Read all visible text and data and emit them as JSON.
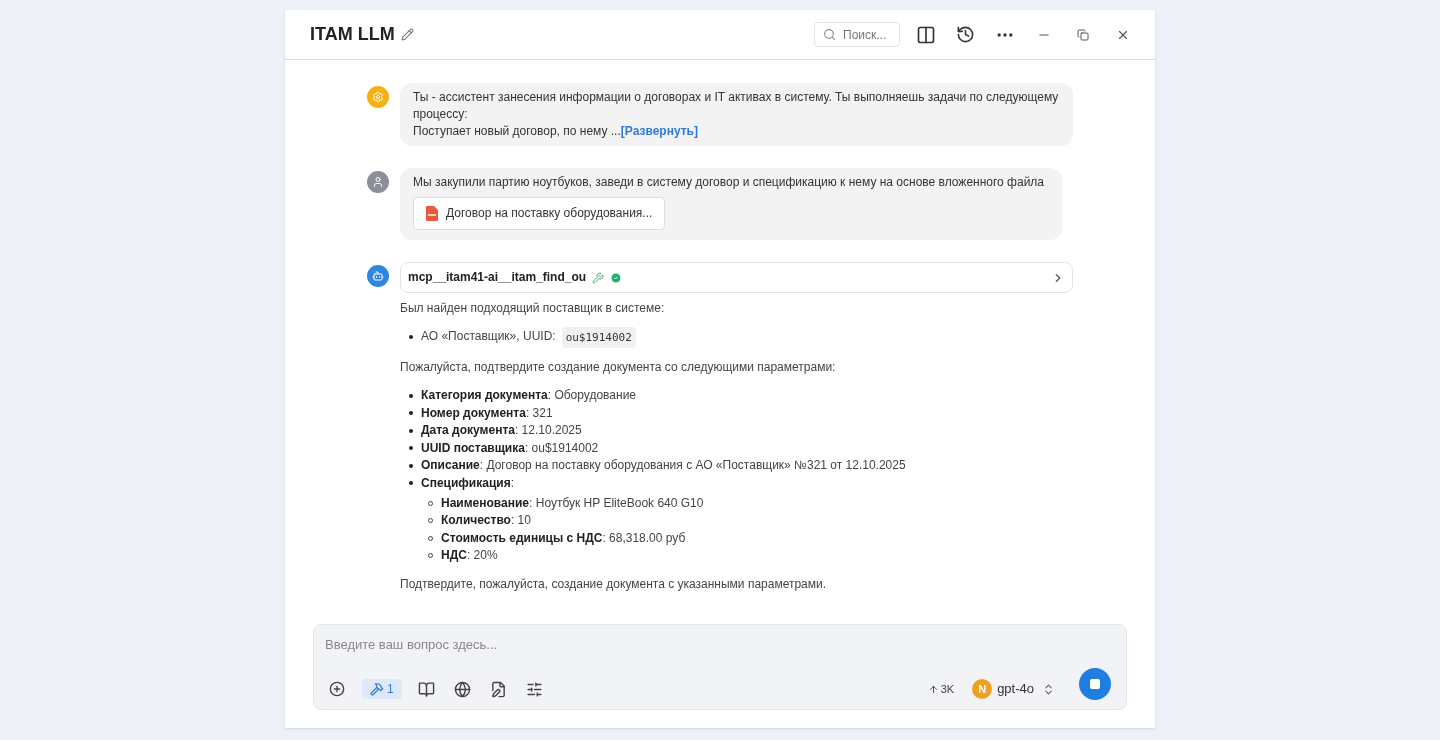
{
  "window": {
    "title": "ITAM LLM",
    "search_placeholder": "Поиск..."
  },
  "messages": [
    {
      "kind": "system",
      "lines": [
        "Ты - ассистент занесения информации о договорах и IT активах в систему. Ты выполняешь задачи по следующему процессу:",
        "Поступает новый договор, по нему ..."
      ],
      "expand_link": "[Развернуть]"
    },
    {
      "kind": "user",
      "text": "Мы закупили партию ноутбуков, заведи в систему договор и спецификацию к нему на основе вложенного файла",
      "attachment": "Договор на поставку оборудования..."
    },
    {
      "kind": "assistant",
      "tool_call": {
        "name": "mcp__itam41-ai__itam_find_ou",
        "success": true
      },
      "intro": "Был найден подходящий поставщик в системе:",
      "supplier": {
        "text": "АО «Поставщик», UUID:",
        "code": "ou$1914002"
      },
      "request": "Пожалуйста, подтвердите создание документа со следующими параметрами:",
      "params": [
        {
          "text": "**Категория документа**: Оборудование"
        },
        {
          "text": "**Номер документа**: 321"
        },
        {
          "text": "**Дата документа**: 12.10.2025"
        },
        {
          "text": "**UUID поставщика**: ou$1914002"
        },
        {
          "text": "**Описание**: Договор на поставку оборудования с АО «Поставщик» №321 от 12.10.2025"
        },
        {
          "text": "**Спецификация**:",
          "children": [
            {
              "text": "**Наименование**: Ноутбук HP EliteBook 640 G10"
            },
            {
              "text": "**Количество**: 10"
            },
            {
              "text": "**Стоимость единицы с НДС**: 68,318.00 руб"
            },
            {
              "text": "**НДС**: 20%"
            }
          ]
        }
      ],
      "closing": "Подтвердите, пожалуйста, создание документа с указанными параметрами."
    }
  ],
  "composer": {
    "placeholder": "Введите ваш вопрос здесь...",
    "tools_count": "1",
    "tools_selected": true,
    "tokens": "3K",
    "model_initial": "N",
    "model": "gpt-4o"
  }
}
